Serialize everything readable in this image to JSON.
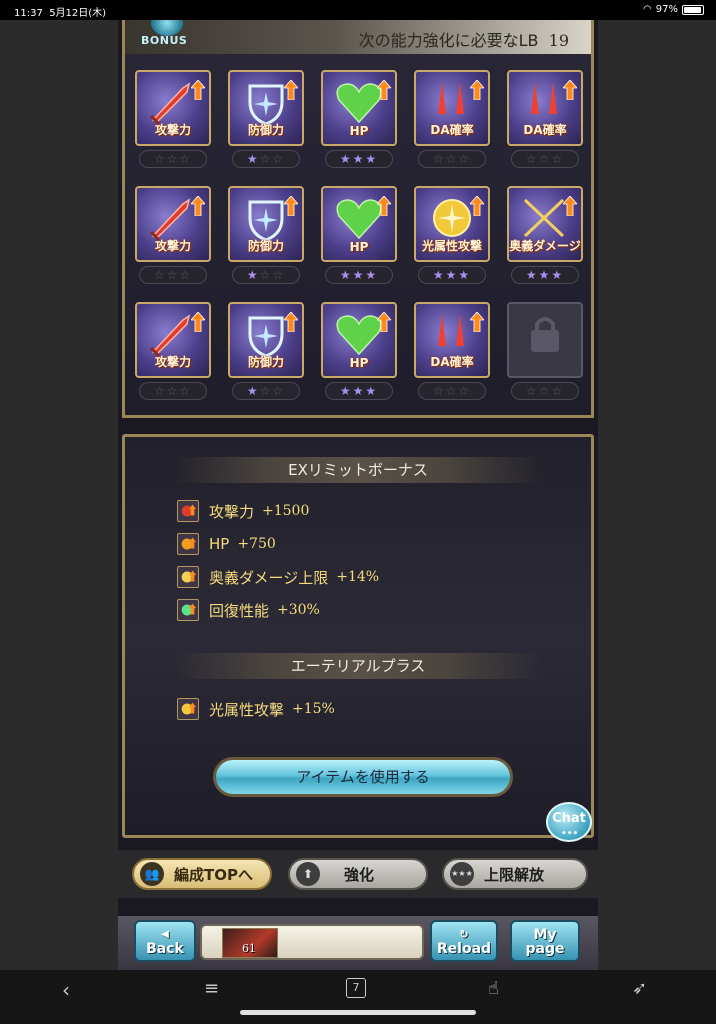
{
  "status_bar": {
    "time": "11:37",
    "date": "5月12日(木)",
    "battery": "97%"
  },
  "lb_header": {
    "badge": "BONUS",
    "text": "次の能力強化に必要なLB",
    "value": "19"
  },
  "lb_grid": [
    [
      {
        "label": "攻撃力",
        "kind": "attack",
        "stars_on": 0,
        "stars": [
          "☆",
          "☆",
          "☆"
        ]
      },
      {
        "label": "防御力",
        "kind": "defense",
        "stars_on": 1,
        "stars": [
          "★",
          "☆",
          "☆"
        ]
      },
      {
        "label": "HP",
        "kind": "hp",
        "stars_on": 3,
        "stars": [
          "★",
          "★",
          "★"
        ]
      },
      {
        "label": "DA確率",
        "kind": "da",
        "stars_on": 0,
        "stars": [
          "☆",
          "☆",
          "☆"
        ]
      },
      {
        "label": "DA確率",
        "kind": "da",
        "stars_on": 0,
        "stars": [
          "☆",
          "☆",
          "☆"
        ]
      }
    ],
    [
      {
        "label": "攻撃力",
        "kind": "attack",
        "stars_on": 0,
        "stars": [
          "☆",
          "☆",
          "☆"
        ]
      },
      {
        "label": "防御力",
        "kind": "defense",
        "stars_on": 1,
        "stars": [
          "★",
          "☆",
          "☆"
        ]
      },
      {
        "label": "HP",
        "kind": "hp",
        "stars_on": 3,
        "stars": [
          "★",
          "★",
          "★"
        ]
      },
      {
        "label": "光属性攻撃",
        "kind": "light",
        "stars_on": 3,
        "stars": [
          "★",
          "★",
          "★"
        ]
      },
      {
        "label": "奥義ダメージ",
        "kind": "ougi",
        "stars_on": 3,
        "stars": [
          "★",
          "★",
          "★"
        ]
      }
    ],
    [
      {
        "label": "攻撃力",
        "kind": "attack",
        "stars_on": 0,
        "stars": [
          "☆",
          "☆",
          "☆"
        ]
      },
      {
        "label": "防御力",
        "kind": "defense",
        "stars_on": 1,
        "stars": [
          "★",
          "☆",
          "☆"
        ]
      },
      {
        "label": "HP",
        "kind": "hp",
        "stars_on": 3,
        "stars": [
          "★",
          "★",
          "★"
        ]
      },
      {
        "label": "DA確率",
        "kind": "da",
        "stars_on": 0,
        "stars": [
          "☆",
          "☆",
          "☆"
        ]
      },
      {
        "label": "",
        "kind": "locked",
        "stars_on": 0,
        "stars": [
          "☆",
          "☆",
          "☆"
        ]
      }
    ]
  ],
  "ex_bonus": {
    "title": "EXリミットボーナス",
    "items": [
      {
        "icon": "attack",
        "name": "攻撃力",
        "value": "+1500"
      },
      {
        "icon": "hp",
        "name": "HP",
        "value": "+750"
      },
      {
        "icon": "ougi",
        "name": "奥義ダメージ上限",
        "value": "+14%"
      },
      {
        "icon": "heal",
        "name": "回復性能",
        "value": "+30%"
      }
    ]
  },
  "aether_plus": {
    "title": "エーテリアルプラス",
    "items": [
      {
        "icon": "light",
        "name": "光属性攻撃",
        "value": "+15%"
      }
    ]
  },
  "use_item_label": "アイテムを使用する",
  "chat_label": "Chat",
  "tabs": [
    {
      "label": "編成TOPへ",
      "icon": "party-icon"
    },
    {
      "label": "強化",
      "icon": "up-arrow-icon"
    },
    {
      "label": "上限解放",
      "icon": "stars-icon"
    }
  ],
  "nav": {
    "back": "Back",
    "reload": "Reload",
    "mypage_1": "My",
    "mypage_2": "page",
    "rank": "61"
  },
  "browser_toolbar": {
    "tab_count": "7"
  },
  "colors": {
    "gold_border": "#9b8658",
    "bonus_text": "#f4dc7e",
    "star_on": "#a98ff0",
    "accent_cyan": "#63c4dc"
  }
}
